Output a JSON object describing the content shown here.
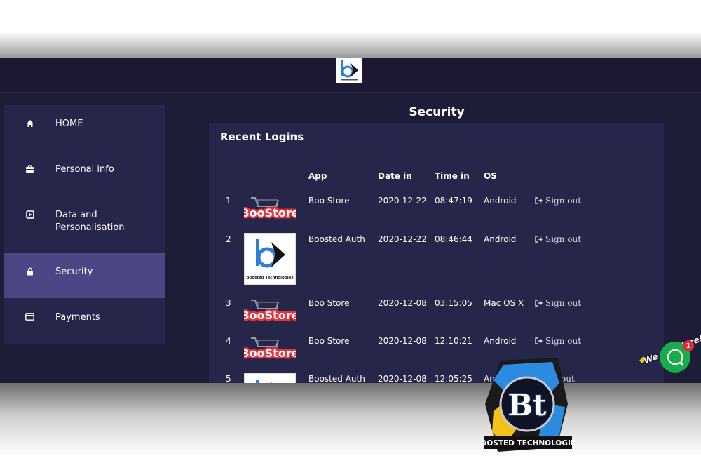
{
  "page_title": "Security",
  "sidebar": {
    "items": [
      {
        "label": "HOME",
        "icon": "home-icon"
      },
      {
        "label": "Personal info",
        "icon": "briefcase-icon"
      },
      {
        "label": "Data and Personalisation",
        "icon": "play-square-icon"
      },
      {
        "label": "Security",
        "icon": "lock-icon",
        "active": true
      },
      {
        "label": "Payments",
        "icon": "credit-card-icon"
      }
    ]
  },
  "card": {
    "title": "Recent Logins",
    "columns": {
      "app": "App",
      "date": "Date in",
      "time": "Time in",
      "os": "OS"
    },
    "rows": [
      {
        "num": "1",
        "logo": "boostore-logo",
        "app": "Boo Store",
        "date": "2020-12-22",
        "time": "08:47:19",
        "os": "Android",
        "action": "Sign out"
      },
      {
        "num": "2",
        "logo": "boosted-technologies-logo",
        "app": "Boosted Auth",
        "date": "2020-12-22",
        "time": "08:46:44",
        "os": "Android",
        "action": "Sign out"
      },
      {
        "num": "3",
        "logo": "boostore-logo",
        "app": "Boo Store",
        "date": "2020-12-08",
        "time": "03:15:05",
        "os": "Mac OS X",
        "action": "Sign out"
      },
      {
        "num": "4",
        "logo": "boostore-logo",
        "app": "Boo Store",
        "date": "2020-12-08",
        "time": "12:10:21",
        "os": "Android",
        "action": "Sign out"
      },
      {
        "num": "5",
        "logo": "boosted-technologies-logo",
        "app": "Boosted Auth",
        "date": "2020-12-08",
        "time": "12:05:25",
        "os": "An",
        "action": "out"
      }
    ]
  },
  "logos": {
    "boostore_text": "BooStore",
    "boosted_tech_text": "Boosted Technologies",
    "watermark_initials": "Bt",
    "watermark_text": "BOOSTED TECHNOLOGIES"
  },
  "chat": {
    "bubble_text": "We Are Here!",
    "badge": "1"
  },
  "colors": {
    "app_bg": "#1e1d38",
    "panel_bg": "#26254a",
    "active_nav": "#4b4785",
    "boostore_red": "#e8323c",
    "chat_green": "#1aab4a"
  }
}
